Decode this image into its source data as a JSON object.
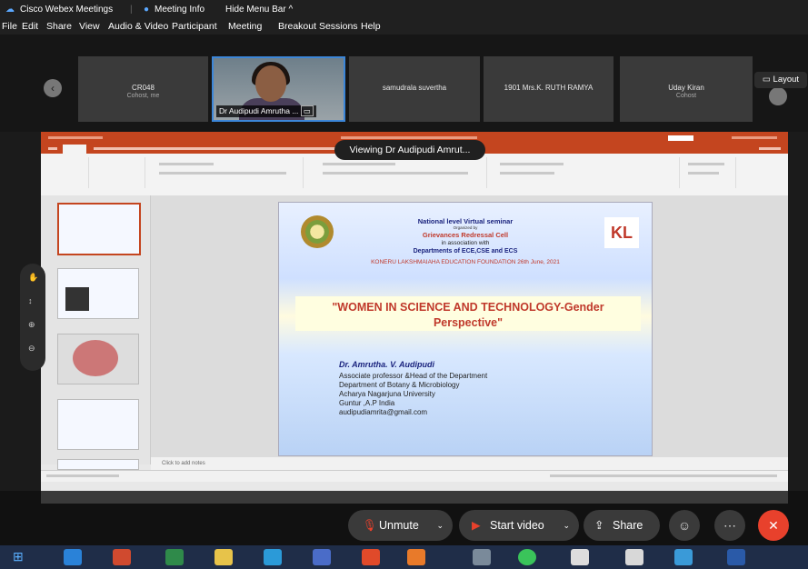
{
  "window": {
    "app_title": "Cisco Webex Meetings",
    "meeting_info": "Meeting Info",
    "hide_menu": "Hide Menu Bar ^"
  },
  "menu": [
    "File",
    "Edit",
    "Share",
    "View",
    "Audio & Video",
    "Participant",
    "Meeting",
    "Breakout Sessions",
    "Help"
  ],
  "participants": [
    {
      "name": "CR048",
      "sub": "Cohost, me"
    },
    {
      "name": "Dr Audipudi Amrutha ..."
    },
    {
      "name": "samudrala suvertha",
      "sub": ""
    },
    {
      "name": "1901 Mrs.K. RUTH RAMYA",
      "sub": ""
    },
    {
      "name": "Uday Kiran",
      "sub": "Cohost"
    }
  ],
  "layout_label": "Layout",
  "viewing_label": "Viewing Dr Audipudi Amrut...",
  "slide": {
    "line1": "National level Virtual seminar",
    "line2": "Organized by",
    "line3": "Grievances Redressal Cell",
    "line4": "in association with",
    "line5": "Departments of ECE,CSE and ECS",
    "line6": "KONERU LAKSHMAIAHA EDUCATION FOUNDATION  26th June, 2021",
    "logo_right": "KL",
    "title1": "\"WOMEN IN SCIENCE AND TECHNOLOGY-Gender",
    "title2": "Perspective\"",
    "author": "Dr. Amrutha. V. Audipudi",
    "a1": "Associate professor &Head of the Department",
    "a2": "Department of Botany & Microbiology",
    "a3": "Acharya Nagarjuna University",
    "a4": "Guntur ,A.P India",
    "a5": "audipudiamrita@gmail.com"
  },
  "notes_placeholder": "Click to add notes",
  "controls": {
    "unmute": "Unmute",
    "start_video": "Start video",
    "share": "Share"
  },
  "colors": {
    "accent_ribbon": "#c4451f",
    "end_button": "#e8412c",
    "title_text": "#c0392b"
  }
}
